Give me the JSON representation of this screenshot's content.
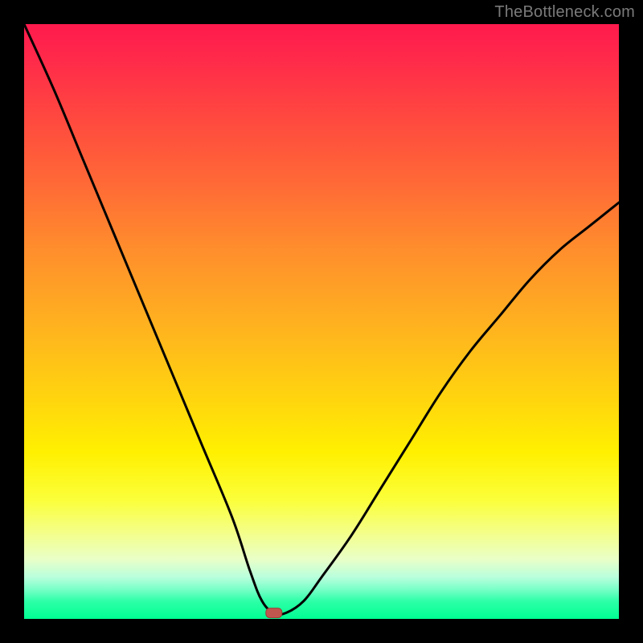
{
  "watermark": "TheBottleneck.com",
  "chart_data": {
    "type": "line",
    "title": "",
    "xlabel": "",
    "ylabel": "",
    "xlim": [
      0,
      100
    ],
    "ylim": [
      0,
      100
    ],
    "grid": false,
    "annotations": [],
    "marker": {
      "x": 42,
      "y": 1,
      "shape": "rounded-rect",
      "color": "#c0574f"
    },
    "notes": "V-shaped curve on a vertical rainbow gradient (red top → green bottom). Axis values are normalized 0–100 estimates (no tick labels in source).",
    "series": [
      {
        "name": "curve",
        "x": [
          0,
          5,
          10,
          15,
          20,
          25,
          30,
          35,
          38,
          40,
          42,
          44,
          47,
          50,
          55,
          60,
          65,
          70,
          75,
          80,
          85,
          90,
          95,
          100
        ],
        "values": [
          100,
          89,
          77,
          65,
          53,
          41,
          29,
          17,
          8,
          3,
          1,
          1,
          3,
          7,
          14,
          22,
          30,
          38,
          45,
          51,
          57,
          62,
          66,
          70
        ]
      }
    ]
  }
}
